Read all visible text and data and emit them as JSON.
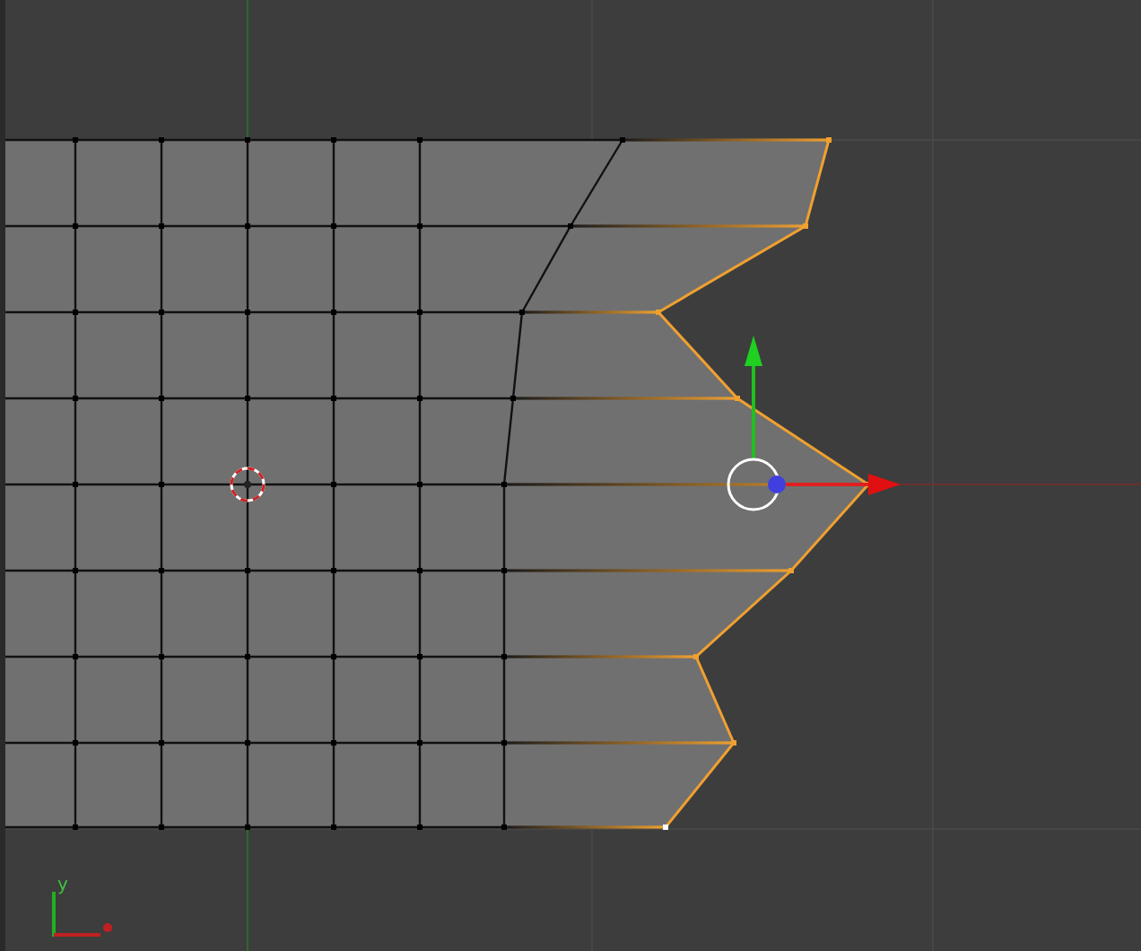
{
  "viewport": {
    "axis_gizmo": {
      "y_label": "y"
    }
  }
}
